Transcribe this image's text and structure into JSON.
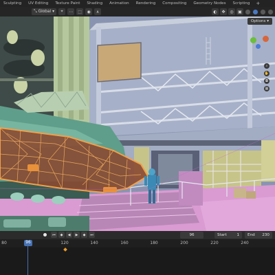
{
  "workspace_tabs": [
    "Sculpting",
    "UV Editing",
    "Texture Paint",
    "Shading",
    "Animation",
    "Rendering",
    "Compositing",
    "Geometry Nodes",
    "Scripting"
  ],
  "workspace_add": "+",
  "viewport_header": {
    "orientation_label": "Global",
    "options_label": "Options"
  },
  "timeline": {
    "current_frame": "96",
    "frame_field": "96",
    "start_label": "Start",
    "start_value": "1",
    "end_label": "End",
    "end_value": "230",
    "ruler_ticks": [
      "80",
      "120",
      "140",
      "160",
      "180",
      "200",
      "220",
      "240"
    ]
  },
  "colors": {
    "accent": "#4772b3",
    "selection": "#e8913a",
    "wall": "#8b97b3",
    "pink_floor": "#d68fd0",
    "tank_green": "#5e9b88"
  }
}
